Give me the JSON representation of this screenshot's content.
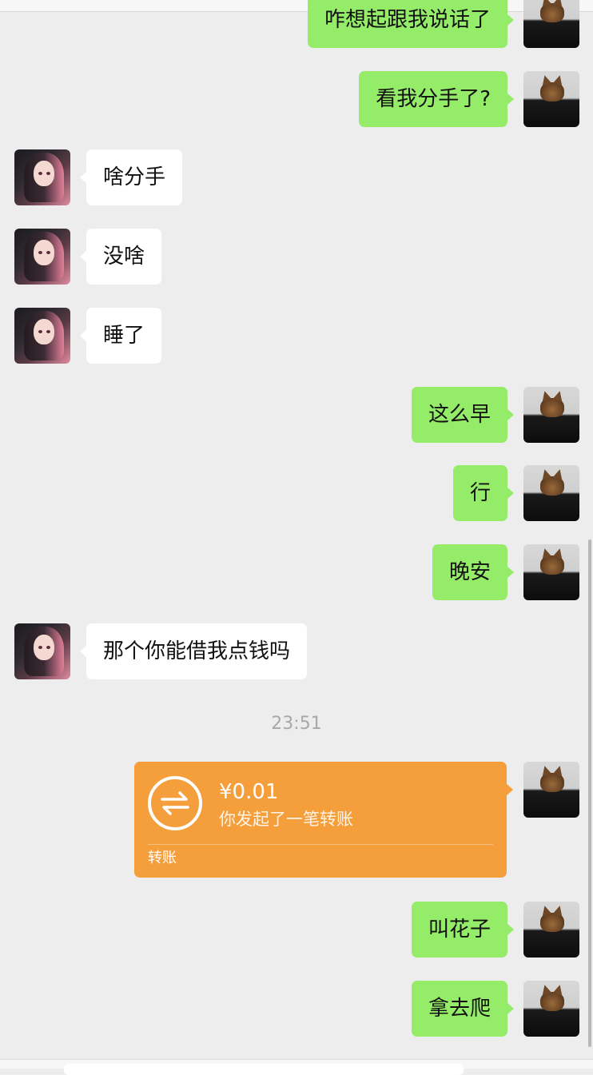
{
  "messages": [
    {
      "sender": "me",
      "text": "咋想起跟我说话了"
    },
    {
      "sender": "me",
      "text": "看我分手了?"
    },
    {
      "sender": "other",
      "text": "啥分手"
    },
    {
      "sender": "other",
      "text": "没啥"
    },
    {
      "sender": "other",
      "text": "睡了"
    },
    {
      "sender": "me",
      "text": "这么早"
    },
    {
      "sender": "me",
      "text": "行"
    },
    {
      "sender": "me",
      "text": "晚安"
    },
    {
      "sender": "other",
      "text": "那个你能借我点钱吗"
    },
    {
      "timestamp": "23:51"
    },
    {
      "sender": "me",
      "transfer": {
        "amount": "¥0.01",
        "description": "你发起了一笔转账",
        "label": "转账"
      }
    },
    {
      "sender": "me",
      "text": "叫花子"
    },
    {
      "sender": "me",
      "text": "拿去爬"
    }
  ],
  "colors": {
    "background": "#ededed",
    "my_bubble": "#95ec69",
    "other_bubble": "#ffffff",
    "transfer_card": "#f59e3c",
    "timestamp_text": "#a8a8a8"
  },
  "icons": {
    "transfer": "transfer-arrows-icon"
  }
}
